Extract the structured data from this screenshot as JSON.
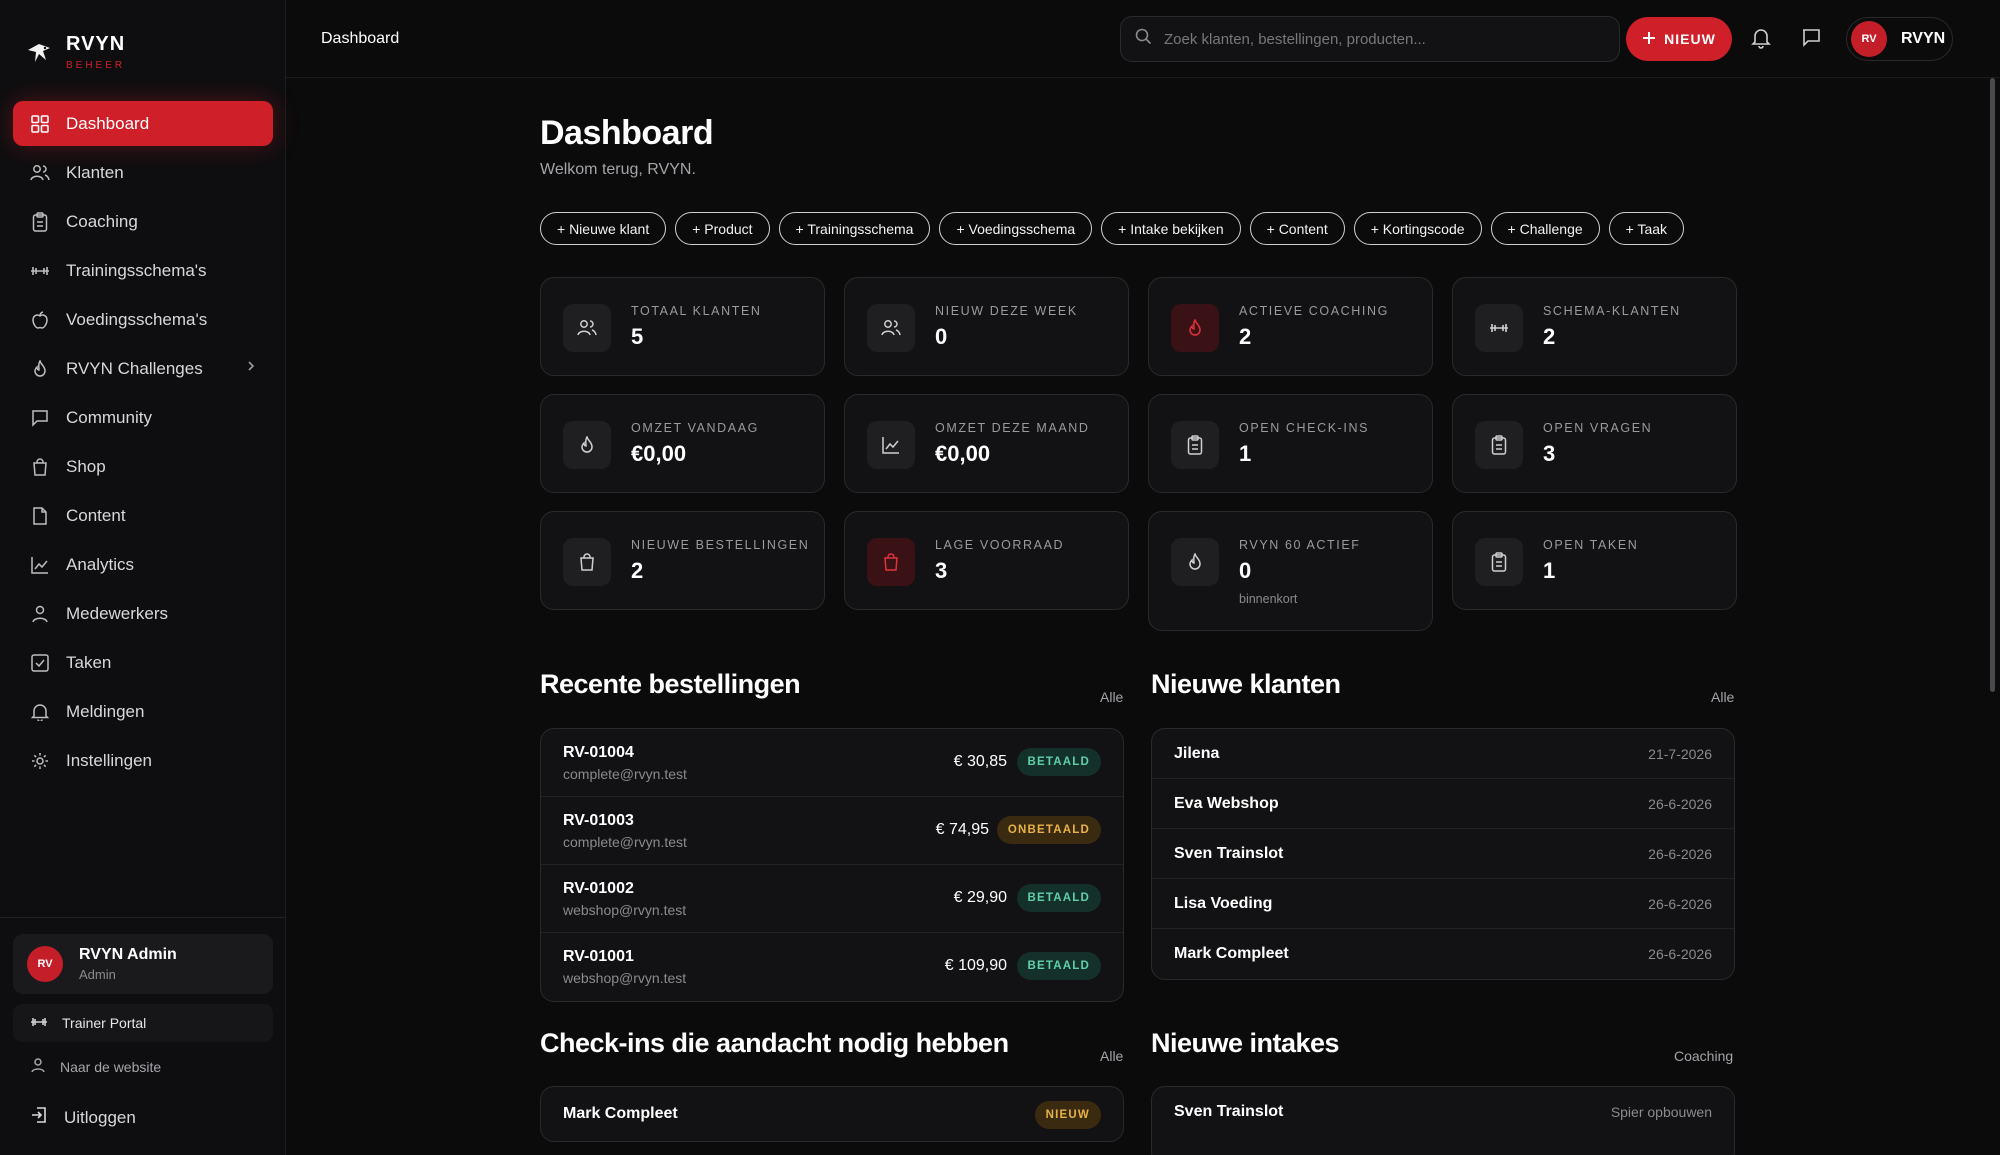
{
  "brand": {
    "name": "RVYN",
    "sub": "BEHEER"
  },
  "sidebar": {
    "items": [
      {
        "label": "Dashboard",
        "icon": "grid-icon"
      },
      {
        "label": "Klanten",
        "icon": "users-icon"
      },
      {
        "label": "Coaching",
        "icon": "clipboard-icon"
      },
      {
        "label": "Trainingsschema's",
        "icon": "dumbbell-icon"
      },
      {
        "label": "Voedingsschema's",
        "icon": "apple-icon"
      },
      {
        "label": "RVYN Challenges",
        "icon": "flame-icon"
      },
      {
        "label": "Community",
        "icon": "chat-icon"
      },
      {
        "label": "Shop",
        "icon": "bag-icon"
      },
      {
        "label": "Content",
        "icon": "file-icon"
      },
      {
        "label": "Analytics",
        "icon": "chart-icon"
      },
      {
        "label": "Medewerkers",
        "icon": "user-icon"
      },
      {
        "label": "Taken",
        "icon": "checkbox-icon"
      },
      {
        "label": "Meldingen",
        "icon": "bell-icon"
      },
      {
        "label": "Instellingen",
        "icon": "gear-icon"
      }
    ],
    "user": {
      "initials": "RV",
      "name": "RVYN Admin",
      "role": "Admin"
    },
    "trainer_portal": "Trainer Portal",
    "website": "Naar de website",
    "logout": "Uitloggen"
  },
  "topbar": {
    "crumb": "Dashboard",
    "search_placeholder": "Zoek klanten, bestellingen, producten...",
    "new_label": "NIEUW",
    "profile_initials": "RV",
    "profile_name": "RVYN"
  },
  "main": {
    "title": "Dashboard",
    "subtitle": "Welkom terug, RVYN.",
    "quick_actions": [
      "+ Nieuwe klant",
      "+ Product",
      "+ Trainingsschema",
      "+ Voedingsschema",
      "+ Intake bekijken",
      "+ Content",
      "+ Kortingscode",
      "+ Challenge",
      "+ Taak"
    ],
    "stats": [
      {
        "label": "TOTAAL KLANTEN",
        "value": "5",
        "icon": "users-icon",
        "accent": false
      },
      {
        "label": "NIEUW DEZE WEEK",
        "value": "0",
        "icon": "users-icon",
        "accent": false
      },
      {
        "label": "ACTIEVE COACHING",
        "value": "2",
        "icon": "flame-icon",
        "accent": true
      },
      {
        "label": "SCHEMA-KLANTEN",
        "value": "2",
        "icon": "dumbbell-icon",
        "accent": false
      },
      {
        "label": "OMZET VANDAAG",
        "value": "€0,00",
        "icon": "flame-icon",
        "accent": false
      },
      {
        "label": "OMZET DEZE MAAND",
        "value": "€0,00",
        "icon": "chart-icon",
        "accent": false
      },
      {
        "label": "OPEN CHECK-INS",
        "value": "1",
        "icon": "clipboard-icon",
        "accent": false
      },
      {
        "label": "OPEN VRAGEN",
        "value": "3",
        "icon": "clipboard-icon",
        "accent": false
      },
      {
        "label": "NIEUWE BESTELLINGEN",
        "value": "2",
        "icon": "bag-icon",
        "accent": false
      },
      {
        "label": "LAGE VOORRAAD",
        "value": "3",
        "icon": "bag-icon",
        "accent": true
      },
      {
        "label": "RVYN 60 ACTIEF",
        "value": "0",
        "note": "binnenkort",
        "icon": "flame-icon",
        "accent": false
      },
      {
        "label": "OPEN TAKEN",
        "value": "1",
        "icon": "clipboard-icon",
        "accent": false
      }
    ],
    "orders": {
      "title": "Recente bestellingen",
      "link": "Alle",
      "rows": [
        {
          "id": "RV-01004",
          "email": "complete@rvyn.test",
          "amount": "€ 30,85",
          "status": "BETAALD",
          "paid": true
        },
        {
          "id": "RV-01003",
          "email": "complete@rvyn.test",
          "amount": "€ 74,95",
          "status": "ONBETAALD",
          "paid": false
        },
        {
          "id": "RV-01002",
          "email": "webshop@rvyn.test",
          "amount": "€ 29,90",
          "status": "BETAALD",
          "paid": true
        },
        {
          "id": "RV-01001",
          "email": "webshop@rvyn.test",
          "amount": "€ 109,90",
          "status": "BETAALD",
          "paid": true
        }
      ]
    },
    "customers": {
      "title": "Nieuwe klanten",
      "link": "Alle",
      "rows": [
        {
          "name": "Jilena",
          "date": "21-7-2026"
        },
        {
          "name": "Eva Webshop",
          "date": "26-6-2026"
        },
        {
          "name": "Sven Trainslot",
          "date": "26-6-2026"
        },
        {
          "name": "Lisa Voeding",
          "date": "26-6-2026"
        },
        {
          "name": "Mark Compleet",
          "date": "26-6-2026"
        }
      ]
    },
    "checkins": {
      "title": "Check-ins die aandacht nodig hebben",
      "link": "Alle",
      "rows": [
        {
          "name": "Mark Compleet",
          "status": "NIEUW"
        }
      ]
    },
    "intakes": {
      "title": "Nieuwe intakes",
      "link": "Coaching",
      "rows": [
        {
          "name": "Sven Trainslot",
          "goal": "Spier opbouwen"
        }
      ]
    }
  },
  "colors": {
    "accent": "#cf1f29",
    "background": "#0b0b0c",
    "card": "#121214",
    "paid": "#5fd0a8",
    "unpaid": "#e8b24a"
  }
}
